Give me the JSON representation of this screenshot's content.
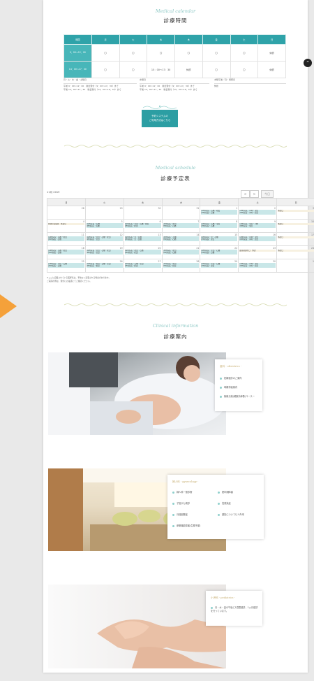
{
  "colors": {
    "accent": "#2fa3a9",
    "accent_light": "#48b6b9",
    "event": "#c9e7e8",
    "gold": "#c6ad70",
    "arrow": "#f5a13a"
  },
  "calendar_section": {
    "script": "Medical calendar",
    "title": "診療時間",
    "headers": [
      "時間",
      "月",
      "火",
      "水",
      "木",
      "金",
      "土",
      "日"
    ],
    "rows": [
      {
        "label": "9：00〜12：00",
        "cells": [
          "〇",
          "〇",
          "〇",
          "〇",
          "〇",
          "〇",
          "休診"
        ]
      },
      {
        "label": "14：00〜17：30",
        "cells": [
          "〇",
          "〇",
          "15：00〜17：30",
          "休診",
          "〇",
          "〇",
          "休診"
        ]
      }
    ],
    "note1": [
      "月・火・木・金・土曜日",
      "午前 9：00〜12：00　新患受付（9：00〜11：30）まで",
      "午後 14：00〜17：30　新患受付（14：00〜16：30）まで"
    ],
    "note2": [
      "水曜日",
      "午前 9：00〜12：00　新患受付（9：00〜11：30）まで",
      "午後 15：00〜17：30　新患受付（15：00〜16：30）まで"
    ],
    "note3": [
      "木曜午後／日・祝祭日",
      "休診"
    ],
    "reservation_button": [
      "予約システムの",
      "ご利用方法はこちら"
    ]
  },
  "schedule_section": {
    "script": "Medical schedule",
    "title": "診療予定表",
    "month_label": "11月 2019",
    "prev_label": "＜",
    "next_label": "＞",
    "today_label": "今日",
    "weekdays": [
      "月",
      "火",
      "水",
      "木",
      "金",
      "土",
      "日"
    ],
    "weeks": [
      [
        {
          "d": "28",
          "e": []
        },
        {
          "d": "29",
          "e": []
        },
        {
          "d": "30",
          "e": []
        },
        {
          "d": "31",
          "e": []
        },
        {
          "d": "1",
          "e": [
            "(AM)院長・石橋・松田",
            "(PM)院長・石橋"
          ]
        },
        {
          "d": "2",
          "e": [
            "(AM)院長・川崎・宝田",
            "(PM)院長・川崎・宝田"
          ]
        },
        {
          "d": "3",
          "e": [
            "休診日"
          ],
          "h": true
        }
      ],
      [
        {
          "d": "4",
          "e": [
            "文化の日振替　休診日"
          ],
          "h": true
        },
        {
          "d": "5",
          "e": [
            "(AM)院長・石橋",
            "(PM)院長・石橋"
          ]
        },
        {
          "d": "6",
          "e": [
            "(AM)院長・宝田・石橋・松田",
            "(PM)院長・松田"
          ]
        },
        {
          "d": "7",
          "e": [
            "(AM)院長・松田",
            "(PM)院長・石橋"
          ]
        },
        {
          "d": "8",
          "e": [
            "(AM)院長・石橋・宝田",
            "(PM)院長・石橋"
          ]
        },
        {
          "d": "9",
          "e": [
            "(AM)院長・宝田・川崎",
            "(PM)院長・宝田"
          ]
        },
        {
          "d": "10",
          "e": [
            "休診日"
          ],
          "h": true
        }
      ],
      [
        {
          "d": "11",
          "e": [
            "(AM)院長・石橋・松田",
            "(PM)院長・石橋"
          ]
        },
        {
          "d": "12",
          "e": [
            "(AM)院長・宝田・石橋・松田",
            "(PM)院長・宝田"
          ]
        },
        {
          "d": "13",
          "e": [
            "(AM)院長・宝・石橋",
            "(PM)院長・宝・石橋"
          ]
        },
        {
          "d": "14",
          "e": [
            "(AM)院長・石橋",
            "(PM)院長・石橋"
          ]
        },
        {
          "d": "15",
          "e": [
            "(AM)院長・宝・石橋",
            "(PM)院長・宝田"
          ]
        },
        {
          "d": "16",
          "e": [
            "(AM)院長・川崎・宝田",
            "(PM)院長・川崎・宝田"
          ]
        },
        {
          "d": "17",
          "e": [
            "休診日"
          ],
          "h": true
        }
      ],
      [
        {
          "d": "18",
          "e": [
            "(AM)院長・石橋・松田",
            "(PM)院長・石橋"
          ]
        },
        {
          "d": "19",
          "e": [
            "(AM)院長・宝田・石橋・松田",
            "(PM)院長・宝田"
          ]
        },
        {
          "d": "20",
          "e": [
            "(AM)院長・松田・石橋",
            "(PM)院長・松田"
          ]
        },
        {
          "d": "21",
          "e": [
            "(AM)院長・松田",
            "(PM)院長・石橋"
          ]
        },
        {
          "d": "22",
          "e": [
            "(AM)院長・宝田・石橋",
            "(PM)院長・石橋"
          ]
        },
        {
          "d": "23",
          "e": [
            "勤労感謝の日　休診"
          ],
          "h": true
        },
        {
          "d": "24",
          "e": [
            "休診日"
          ],
          "h": true
        }
      ],
      [
        {
          "d": "25",
          "e": [
            "(AM)院長・宝田・石橋",
            "(PM)院長・石橋"
          ]
        },
        {
          "d": "26",
          "e": [
            "(AM)院長・松田・石橋・宝田",
            "(PM)院長・松田"
          ]
        },
        {
          "d": "27",
          "e": [
            "(AM)院長・石橋・宝田",
            "(PM)院長・松田"
          ]
        },
        {
          "d": "28",
          "e": [
            "(AM)院長・松田",
            "(PM)院長・松田"
          ]
        },
        {
          "d": "29",
          "e": [
            "(AM)院長・宝田・石橋",
            "(PM)院長・宝田"
          ]
        },
        {
          "d": "30",
          "e": [
            "(AM)院長・川崎・宝田",
            "(PM)院長・川崎・宝田"
          ]
        },
        {
          "d": "1",
          "e": []
        }
      ]
    ],
    "footnote": [
      "※ここに記載されている医師名は、予告なく変更される場合があります。",
      "ご来院の際は、受付にお電話にてご確認ください。"
    ]
  },
  "info_section": {
    "script": "Clinical information",
    "title": "診療案内",
    "cards": [
      {
        "title": "産科 - obstetrics -",
        "items": [
          "妊婦健診のご案内",
          "母親学級案内",
          "無痛分娩(硬膜外麻酔)コース一"
        ]
      },
      {
        "title": "婦人科 - gynecology -",
        "items": [
          "婦人科一般診療",
          "更年期障害",
          "子宮がん検診",
          "性感染症",
          "月経困難症",
          "避妊についてピル外来",
          "卵巣機能障害(生理不順)"
        ]
      },
      {
        "title": "小児科 - pediatrics -",
        "items": [
          "月・水・金の午後に1週間健診、1ヵ月健診を行っています。"
        ]
      }
    ]
  }
}
